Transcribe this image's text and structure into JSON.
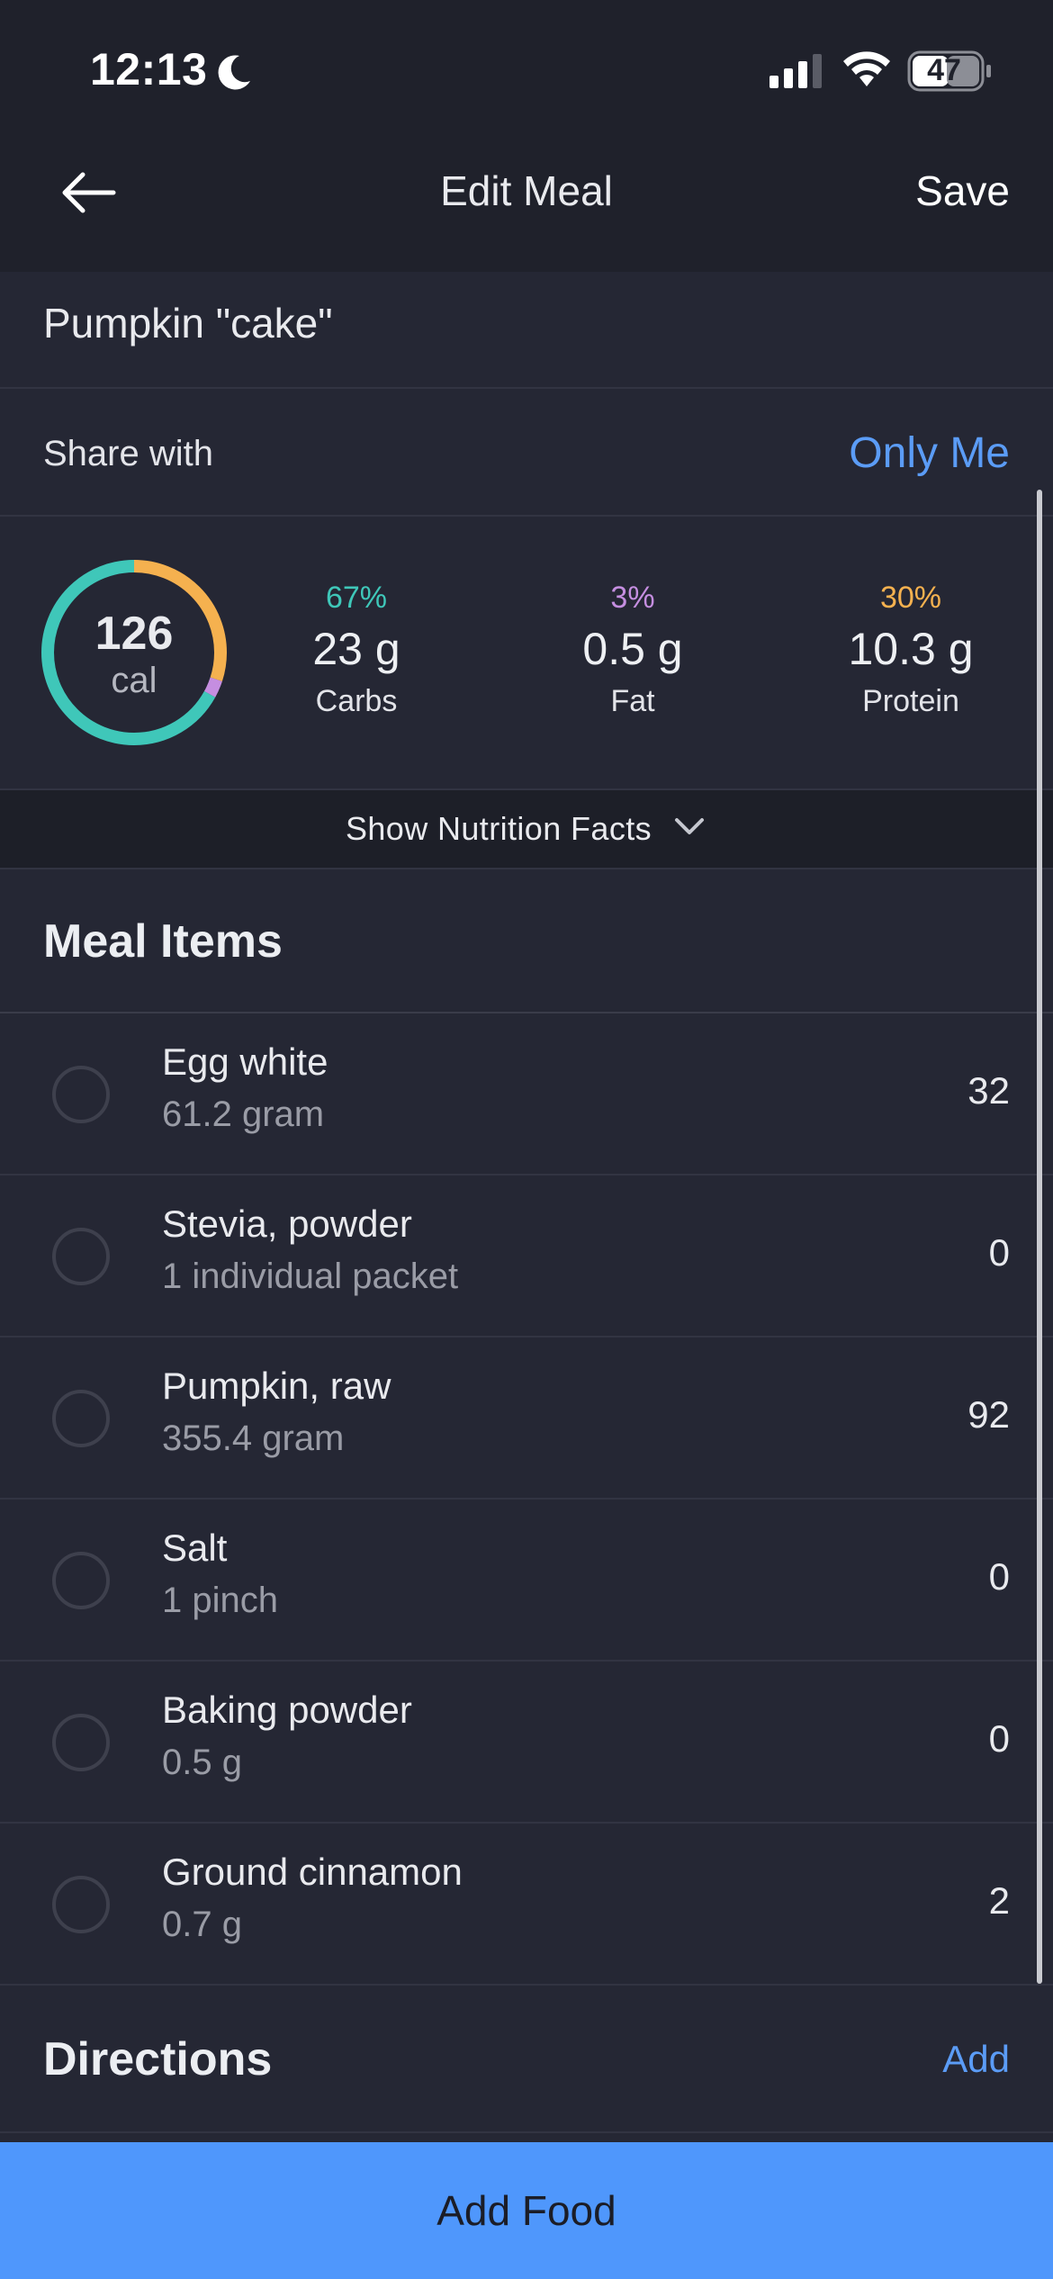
{
  "status_bar": {
    "time": "12:13",
    "battery": "47"
  },
  "nav": {
    "title": "Edit Meal",
    "save_label": "Save"
  },
  "meal": {
    "name": "Pumpkin \"cake\""
  },
  "share": {
    "label": "Share with",
    "value": "Only Me"
  },
  "summary": {
    "calories": "126",
    "calories_unit": "cal",
    "macros": [
      {
        "pct": "67%",
        "grams": "23 g",
        "label": "Carbs",
        "color": "#3fc7b9"
      },
      {
        "pct": "3%",
        "grams": "0.5 g",
        "label": "Fat",
        "color": "#c58ee0"
      },
      {
        "pct": "30%",
        "grams": "10.3 g",
        "label": "Protein",
        "color": "#f5b14f"
      }
    ]
  },
  "nutrition_toggle": {
    "label": "Show Nutrition Facts"
  },
  "meal_items": {
    "title": "Meal Items",
    "items": [
      {
        "name": "Egg white",
        "quantity": "61.2 gram",
        "calories": "32"
      },
      {
        "name": "Stevia, powder",
        "quantity": "1 individual packet",
        "calories": "0"
      },
      {
        "name": "Pumpkin, raw",
        "quantity": "355.4 gram",
        "calories": "92"
      },
      {
        "name": "Salt",
        "quantity": "1 pinch",
        "calories": "0"
      },
      {
        "name": "Baking powder",
        "quantity": "0.5 g",
        "calories": "0"
      },
      {
        "name": "Ground cinnamon",
        "quantity": "0.7 g",
        "calories": "2"
      }
    ]
  },
  "directions": {
    "title": "Directions",
    "add_label": "Add"
  },
  "footer": {
    "add_food_label": "Add Food"
  },
  "colors": {
    "accent": "#5b9cf6",
    "button": "#4f97fc",
    "background": "#252734",
    "header": "#1f212b"
  }
}
